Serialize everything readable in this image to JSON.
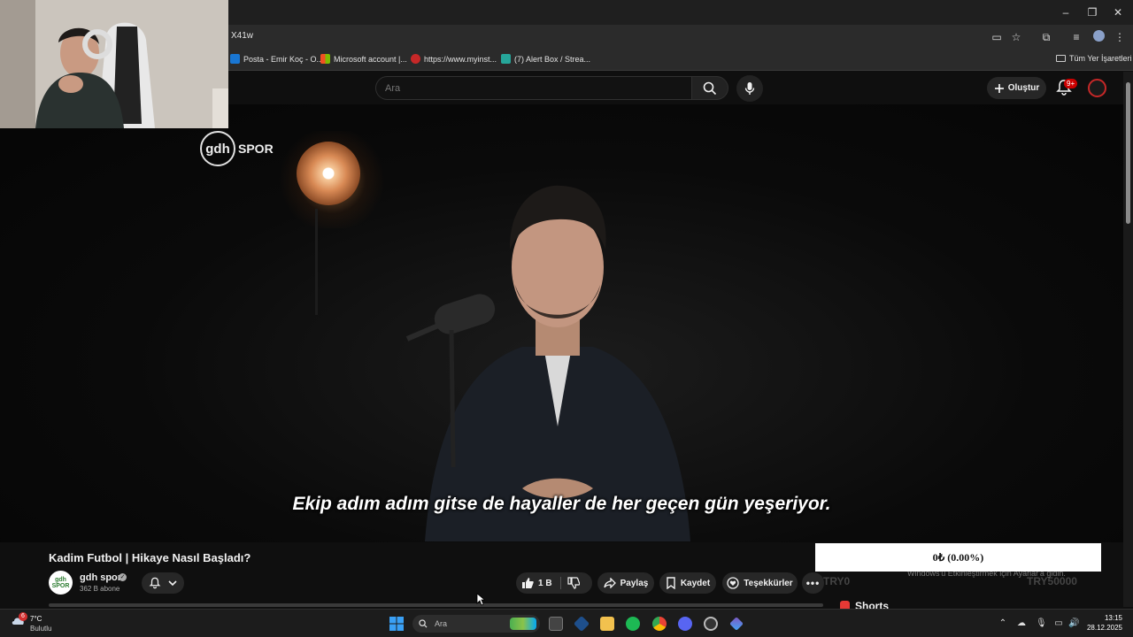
{
  "browser": {
    "url_fragment": "X41w",
    "bookmarks": [
      {
        "label": "Posta - Emir Koç - O...",
        "color": "#1976d2"
      },
      {
        "label": "Microsoft account |...",
        "color": "#f25022"
      },
      {
        "label": "https://www.myinst...",
        "color": "#c62828"
      },
      {
        "label": "(7) Alert Box / Strea...",
        "color": "#26a69a"
      }
    ],
    "all_bookmarks_label": "Tüm Yer İşaretleri"
  },
  "header": {
    "search_placeholder": "Ara",
    "create_label": "Oluştur",
    "notification_badge": "9+"
  },
  "video": {
    "channel_logo_text": "gdh",
    "channel_logo_suffix": "SPOR",
    "subtitle": "Ekip adım adım gitse de hayaller de her geçen gün yeşeriyor."
  },
  "info": {
    "title": "Kadim Futbol | Hikaye Nasıl Başladı?",
    "channel_avatar_text": "gdh SPOR",
    "channel_name": "gdh spor",
    "subscribers": "362 B abone",
    "likes": "1 B",
    "share_label": "Paylaş",
    "save_label": "Kaydet",
    "thanks_label": "Teşekkürler",
    "shorts_label": "Shorts"
  },
  "overlay": {
    "donation_text": "0₺ (0.00%)",
    "ghost_left": "TRY0",
    "ghost_right": "TRY50000",
    "ghost_windows": "Windows'u Etkinleştirmek için Ayarlar'a gidin."
  },
  "taskbar": {
    "weather_badge": "6",
    "temperature": "7°C",
    "weather_desc": "Bulutlu",
    "search_placeholder": "Ara",
    "time": "13:15",
    "date": "28.12.2025"
  }
}
